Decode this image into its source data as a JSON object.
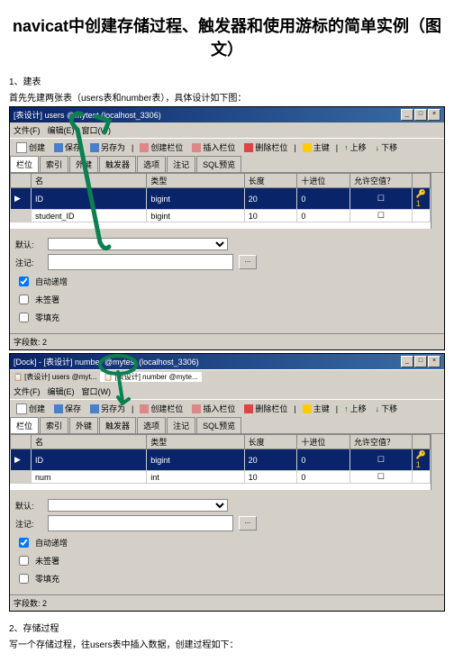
{
  "title": "navicat中创建存储过程、触发器和使用游标的简单实例（图文）",
  "section1": {
    "num": "1、建表",
    "desc": "首先先建两张表（users表和number表），具体设计如下图："
  },
  "section2": {
    "num": "2、存储过程",
    "desc": "写一个存储过程，往users表中插入数据，创建过程如下："
  },
  "win1": {
    "title": "[表设计] users @mytest (localhost_3306)",
    "menu": [
      "文件(F)",
      "编辑(E)",
      "窗口(W)"
    ],
    "toolbar": {
      "new": "创建",
      "save": "保存",
      "saveas": "另存为",
      "addcol": "创建栏位",
      "inscol": "插入栏位",
      "delcol": "删除栏位",
      "pk": "主键",
      "up": "上移",
      "down": "下移"
    },
    "tabs": [
      "栏位",
      "索引",
      "外键",
      "触发器",
      "选项",
      "注记",
      "SQL预览"
    ],
    "cols": {
      "name": "名",
      "type": "类型",
      "len": "长度",
      "dec": "十进位",
      "null": "允许空值？"
    },
    "rows": [
      {
        "name": "ID",
        "type": "bigint",
        "len": "20",
        "dec": "0",
        "null": false,
        "pk": true
      },
      {
        "name": "student_ID",
        "type": "bigint",
        "len": "10",
        "dec": "0",
        "null": false,
        "pk": false
      }
    ],
    "form": {
      "default": "默认:",
      "comment": "注记:",
      "auto": "自动递增",
      "unsigned": "未签署",
      "zerofill": "零填充"
    },
    "status": "字段数: 2"
  },
  "win2": {
    "title": "[Dock] - [表设计] number @mytest (localhost_3306)",
    "tabtitle": "[表设计] users @myt... [表设计] number @myte...",
    "menu": [
      "文件(F)",
      "编辑(E)",
      "窗口(W)"
    ],
    "toolbar": {
      "new": "创建",
      "save": "保存",
      "saveas": "另存为",
      "addcol": "创建栏位",
      "inscol": "插入栏位",
      "delcol": "删除栏位",
      "pk": "主键",
      "up": "上移",
      "down": "下移"
    },
    "tabs": [
      "栏位",
      "索引",
      "外键",
      "触发器",
      "选项",
      "注记",
      "SQL预览"
    ],
    "cols": {
      "name": "名",
      "type": "类型",
      "len": "长度",
      "dec": "十进位",
      "null": "允许空值？"
    },
    "rows": [
      {
        "name": "ID",
        "type": "bigint",
        "len": "20",
        "dec": "0",
        "null": false,
        "pk": true
      },
      {
        "name": "num",
        "type": "int",
        "len": "10",
        "dec": "0",
        "null": false,
        "pk": false
      }
    ],
    "form": {
      "default": "默认:",
      "comment": "注记:",
      "auto": "自动递增",
      "unsigned": "未签署",
      "zerofill": "零填充"
    },
    "status": "字段数: 2"
  }
}
